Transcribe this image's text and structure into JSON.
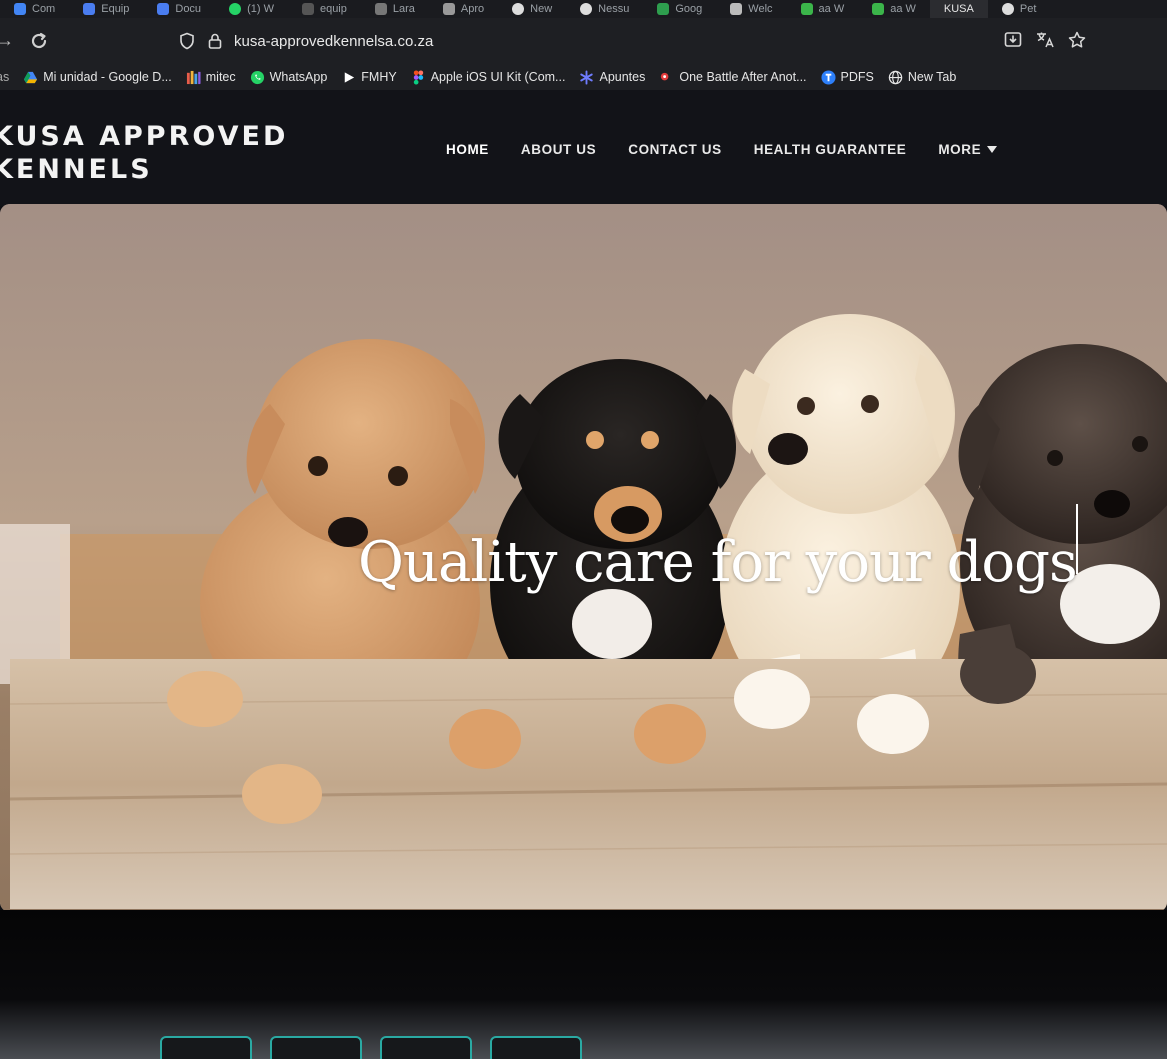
{
  "browser": {
    "tabs": [
      "Com",
      "Equip",
      "Docu",
      "(1) W",
      "equip",
      "Lara",
      "Apro",
      "New",
      "Nessu",
      "Goog",
      "Welc",
      "aa W",
      "aa W",
      "KUSA",
      "Pet"
    ],
    "url": "kusa-approvedkennelsa.co.za",
    "bookmarks": [
      {
        "label": "as",
        "icon": "bookmark-icon"
      },
      {
        "label": "Mi unidad - Google D...",
        "icon": "google-drive-icon",
        "color": "#4285F4"
      },
      {
        "label": "mitec",
        "icon": "bar-chart-icon",
        "color": "#e8a23a"
      },
      {
        "label": "WhatsApp",
        "icon": "whatsapp-icon",
        "color": "#25D366"
      },
      {
        "label": "FMHY",
        "icon": "play-icon",
        "color": "#ffffff"
      },
      {
        "label": "Apple iOS UI Kit (Com...",
        "icon": "figma-icon",
        "color": "#F24E1E"
      },
      {
        "label": "Apuntes",
        "icon": "snowflake-icon",
        "color": "#6f7cff"
      },
      {
        "label": "One Battle After Anot...",
        "icon": "red-dot-icon",
        "color": "#e23b3b"
      },
      {
        "label": "PDFS",
        "icon": "pdf-icon",
        "color": "#2d7ff9"
      },
      {
        "label": "New Tab",
        "icon": "globe-icon",
        "color": "#e6e6e6"
      }
    ]
  },
  "site": {
    "logo_line1": "KUSA APPROVED",
    "logo_line2": "KENNELS",
    "nav": {
      "home": "HOME",
      "about": "ABOUT US",
      "contact": "CONTACT US",
      "health": "HEALTH GUARANTEE",
      "more": "MORE"
    },
    "hero_title": "Quality care for your dogs"
  },
  "colors": {
    "page_bg": "#0f1014",
    "header_bg": "#121318",
    "accent_key": "#2aa9a3"
  }
}
